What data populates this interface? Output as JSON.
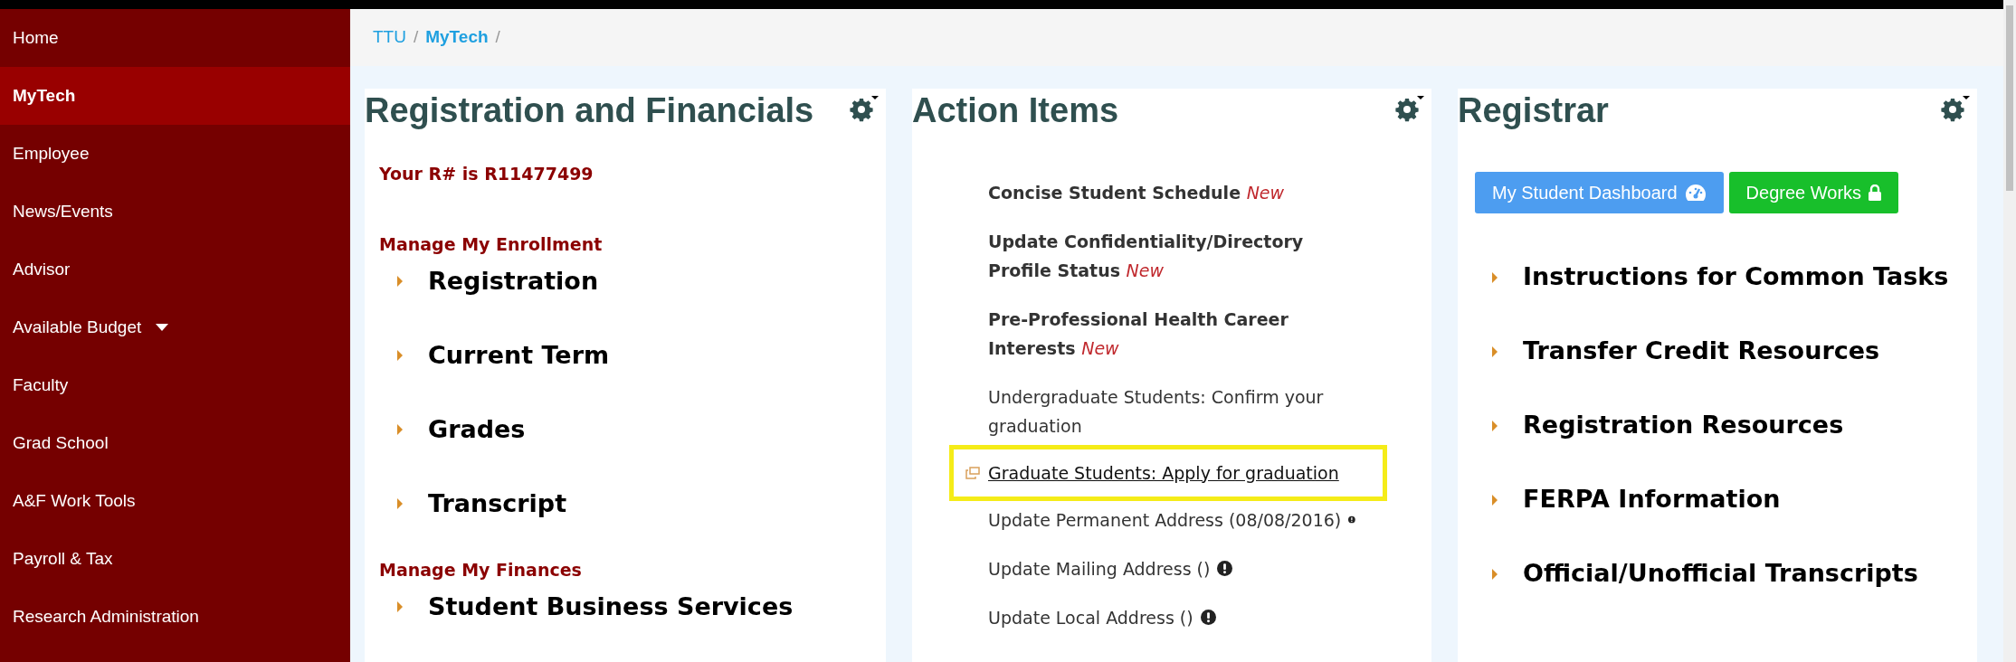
{
  "sidebar": {
    "items": [
      {
        "label": "Home",
        "selected": false,
        "has_menu": false
      },
      {
        "label": "MyTech",
        "selected": true,
        "has_menu": false
      },
      {
        "label": "Employee",
        "selected": false,
        "has_menu": false
      },
      {
        "label": "News/Events",
        "selected": false,
        "has_menu": false
      },
      {
        "label": "Advisor",
        "selected": false,
        "has_menu": false
      },
      {
        "label": "Available Budget",
        "selected": false,
        "has_menu": true
      },
      {
        "label": "Faculty",
        "selected": false,
        "has_menu": false
      },
      {
        "label": "Grad School",
        "selected": false,
        "has_menu": false
      },
      {
        "label": "A&F Work Tools",
        "selected": false,
        "has_menu": false
      },
      {
        "label": "Payroll & Tax",
        "selected": false,
        "has_menu": false
      },
      {
        "label": "Research Administration",
        "selected": false,
        "has_menu": false
      }
    ]
  },
  "breadcrumb": [
    {
      "label": "TTU",
      "current": false,
      "separator": "/"
    },
    {
      "label": "MyTech",
      "current": true,
      "separator": "/"
    }
  ],
  "panels": [
    {
      "title": "Registration and Financials",
      "blocks": [
        {
          "kind": "note",
          "text": "Your R# is R11477499"
        },
        {
          "kind": "heading",
          "text": "Manage My Enrollment"
        },
        {
          "kind": "link",
          "text": "Registration"
        },
        {
          "kind": "link",
          "text": "Current Term"
        },
        {
          "kind": "link",
          "text": "Grades"
        },
        {
          "kind": "link",
          "text": "Transcript"
        },
        {
          "kind": "heading",
          "text": "Manage My Finances"
        },
        {
          "kind": "link",
          "text": "Student Business Services"
        }
      ]
    },
    {
      "title": "Action Items",
      "items": [
        {
          "kind": "bold",
          "text": "Concise Student Schedule",
          "badge": "New",
          "highlighted": false
        },
        {
          "kind": "bold",
          "text": "Update Confidentiality/Directory Profile Status",
          "badge": "New",
          "highlighted": false
        },
        {
          "kind": "bold",
          "text": "Pre-Professional Health Career Interests",
          "badge": "New",
          "highlighted": false
        },
        {
          "kind": "plain",
          "text": "Undergraduate Students: Confirm your graduation",
          "highlighted": false
        },
        {
          "kind": "external",
          "text": "Graduate Students: Apply for graduation",
          "highlighted": true
        },
        {
          "kind": "alert",
          "text": "Update Permanent Address (08/08/2016)",
          "highlighted": false
        },
        {
          "kind": "alert",
          "text": "Update Mailing Address ()",
          "highlighted": false
        },
        {
          "kind": "alert",
          "text": "Update Local Address ()",
          "highlighted": false
        }
      ]
    },
    {
      "title": "Registrar",
      "buttons": [
        {
          "label": "My Student Dashboard",
          "kind": "dashboard"
        },
        {
          "label": "Degree Works",
          "kind": "locked"
        }
      ],
      "links": [
        "Instructions for Common Tasks",
        "Transfer Credit Resources",
        "Registration Resources",
        "FERPA Information",
        "Official/Unofficial Transcripts"
      ]
    }
  ]
}
